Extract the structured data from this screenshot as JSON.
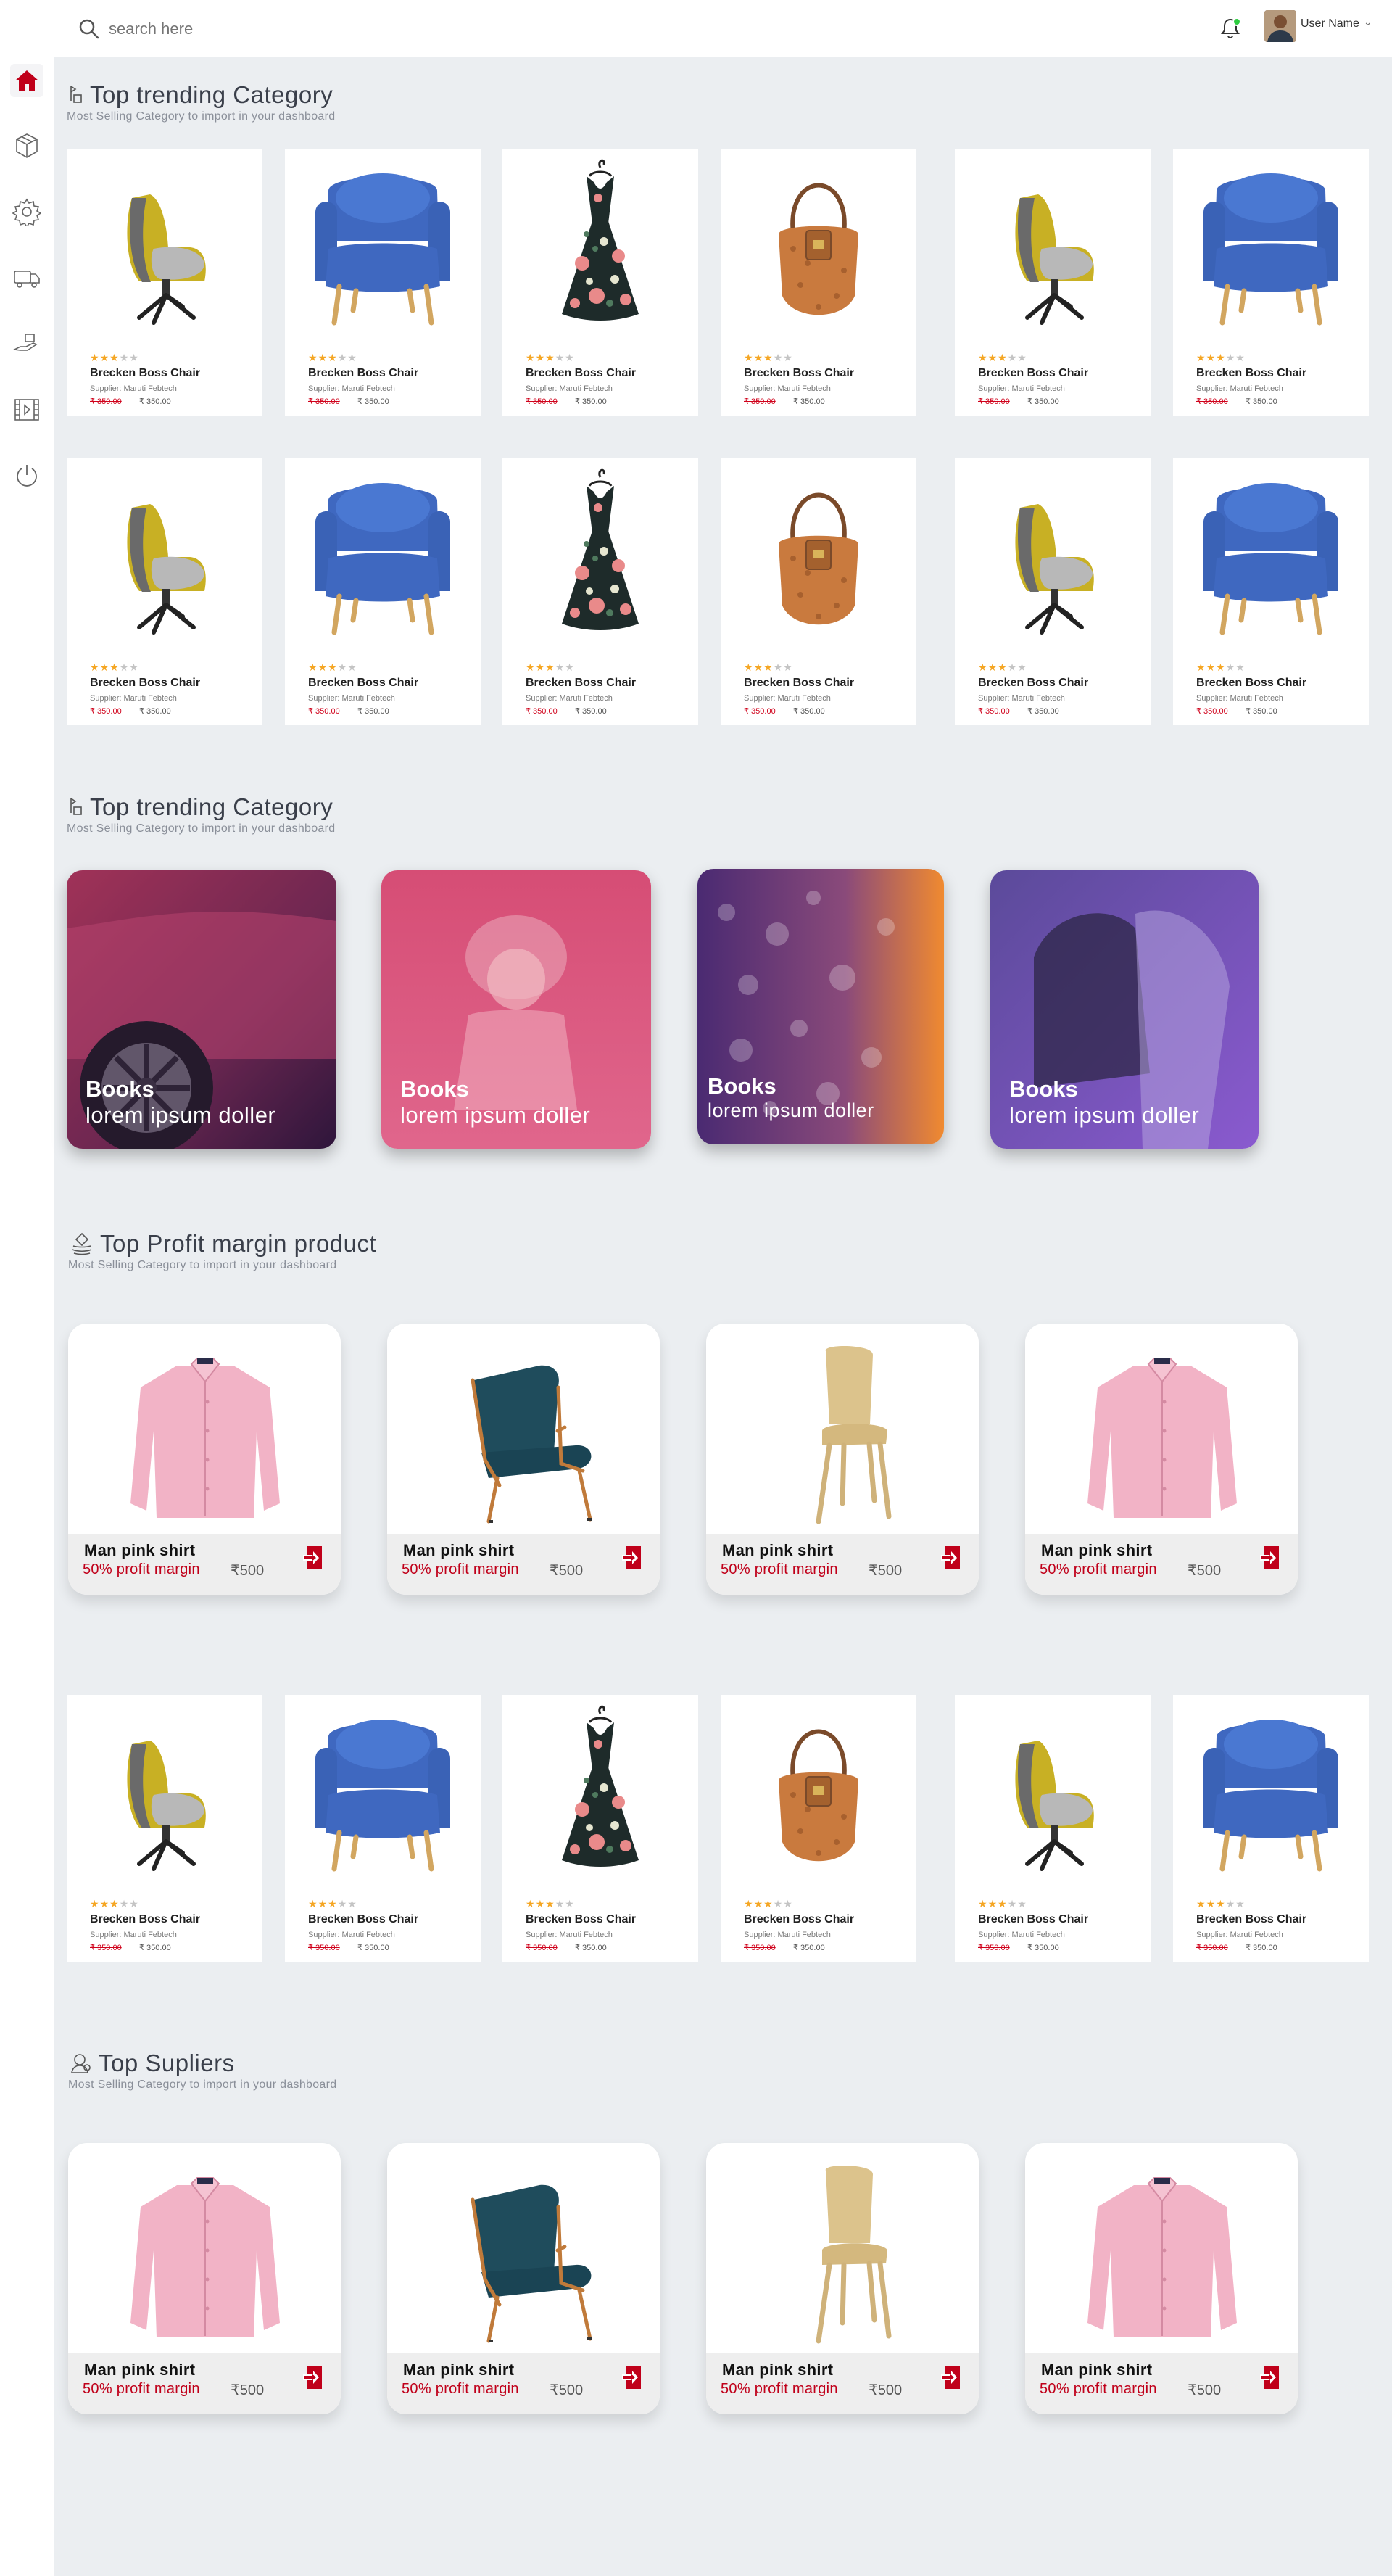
{
  "header": {
    "search_placeholder": "search here",
    "user_name": "User Name",
    "caret": "⌄"
  },
  "sidebar": {
    "items": [
      {
        "icon": "home-icon",
        "active": true
      },
      {
        "icon": "box-icon"
      },
      {
        "icon": "gear-icon"
      },
      {
        "icon": "truck-icon"
      },
      {
        "icon": "hand-box-icon"
      },
      {
        "icon": "film-icon"
      },
      {
        "icon": "power-icon"
      }
    ]
  },
  "sections": {
    "trending1": {
      "title": "Top trending Category",
      "subtitle": "Most Selling Category to import in your dashboard"
    },
    "trending2": {
      "title": "Top trending Category",
      "subtitle": "Most Selling Category to import in your dashboard"
    },
    "profit": {
      "title": "Top Profit margin product",
      "subtitle": "Most Selling Category to import in your dashboard"
    },
    "suppliers": {
      "title": "Top Supliers",
      "subtitle": "Most Selling Category to import in your dashboard"
    }
  },
  "product": {
    "name": "Brecken Boss Chair",
    "supplier": "Supplier: Maruti Febtech",
    "old_price": "₹ 350.00",
    "new_price": "₹ 350.00",
    "rating": 3,
    "max_rating": 5
  },
  "categories": [
    {
      "title": "Books",
      "subtitle": "lorem ipsum doller"
    },
    {
      "title": "Books",
      "subtitle": "lorem ipsum doller"
    },
    {
      "title": "Books",
      "subtitle": "lorem ipsum doller"
    },
    {
      "title": "Books",
      "subtitle": "lorem ipsum doller"
    }
  ],
  "margin_product": {
    "name": "Man pink shirt",
    "margin": "50% profit margin",
    "price": "₹500"
  },
  "colors": {
    "accent": "#c0001a",
    "star": "#f5a623",
    "background": "#ebeef1"
  }
}
